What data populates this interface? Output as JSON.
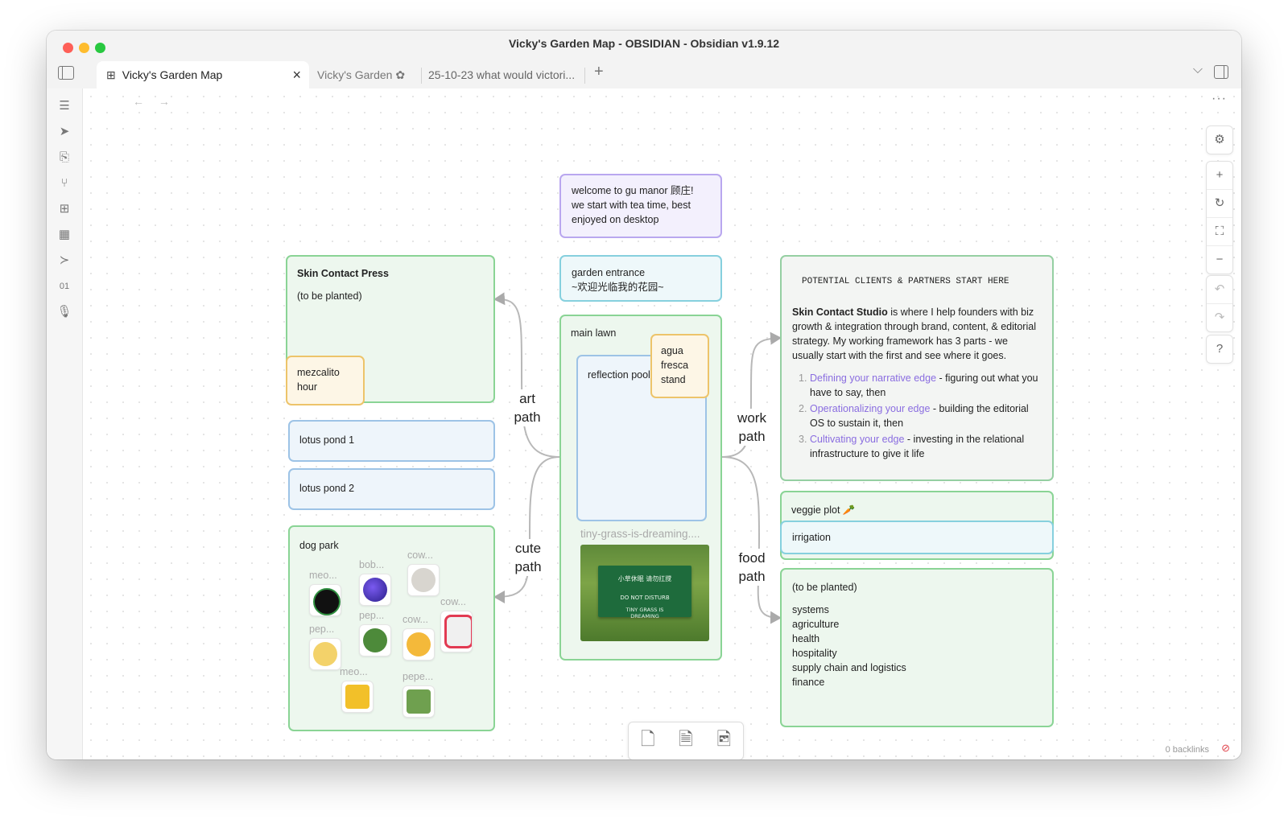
{
  "window": {
    "title": "Vicky's Garden Map - OBSIDIAN - Obsidian v1.9.12"
  },
  "tabs": [
    {
      "label": "Vicky's Garden Map",
      "icon": "canvas-icon"
    },
    {
      "label": "Vicky's Garden ✿"
    },
    {
      "label": "25-10-23 what would victori..."
    }
  ],
  "tab_actions": {
    "new_tab": "+",
    "list": "⌵"
  },
  "ribbon": [
    "files-icon",
    "send-icon",
    "file-search-icon",
    "graph-icon",
    "canvas-icon",
    "calendar-icon",
    "terminal-icon",
    "binary-icon",
    "microphone-icon"
  ],
  "nav": {
    "back": "←",
    "forward": "→",
    "more": "···"
  },
  "controls": {
    "settings": "⚙",
    "zoom_in": "+",
    "reset": "↻",
    "fit": "⛶",
    "zoom_out": "−",
    "undo": "↶",
    "redo": "↷",
    "help": "?"
  },
  "nodes": {
    "welcome": "welcome to gu manor 顾庄!\nwe start with tea time, best enjoyed on desktop",
    "entrance_1": "garden entrance",
    "entrance_2": "~欢迎光临我的花园~",
    "main_lawn": "main lawn",
    "reflection_pool": "reflection pool",
    "agua_fresca": "agua fresca stand",
    "tiny_grass_label": "tiny-grass-is-dreaming....",
    "sign_line1": "小草休眠 请勿扛搅",
    "sign_line2": "DO NOT DISTURB",
    "sign_line3": "TINY GRASS IS DREAMING",
    "skin_contact_press": "Skin Contact Press",
    "to_be_planted": "(to be planted)",
    "mezcalito": "mezcalito hour",
    "lotus1": "lotus pond 1",
    "lotus2": "lotus pond 2",
    "dog_park": "dog park",
    "potential_clients": "POTENTIAL CLIENTS & PARTNERS START HERE",
    "studio_name": "Skin Contact Studio",
    "studio_intro": " is where I help founders with biz growth & integration through brand, content, & editorial strategy. My working framework has 3 parts - we usually start with the first and see where it goes.",
    "steps": [
      {
        "num": "1.",
        "link": "Defining your narrative edge",
        "rest": " - figuring out what you have to say, then"
      },
      {
        "num": "2.",
        "link": "Operationalizing your edge",
        "rest": " - building the editorial OS to sustain it, then"
      },
      {
        "num": "3.",
        "link": "Cultivating your edge",
        "rest": " - investing in the relational infrastructure to give it life"
      }
    ],
    "veggie_plot": "veggie plot 🥕",
    "irrigation": "irrigation",
    "to_be_planted2": "(to be planted)",
    "sectors": [
      "systems",
      "agriculture",
      "health",
      "hospitality",
      "supply chain and logistics",
      "finance"
    ]
  },
  "edges": {
    "art": "art path",
    "cute": "cute path",
    "work": "work path",
    "food": "food path"
  },
  "emoji_labels": [
    "meo...",
    "bob...",
    "cow...",
    "cow...",
    "pep...",
    "pep...",
    "cow...",
    "pep...",
    "meo...",
    "pepe..."
  ],
  "colors": {
    "green": "#8ad495",
    "purple": "#b9a7ef",
    "cyan": "#86d0de",
    "blue": "#9dc3e6",
    "orange": "#edc46a",
    "link": "#8a6de0"
  },
  "bottom_tools": [
    "empty-card-icon",
    "note-card-icon",
    "media-card-icon"
  ],
  "status": {
    "backlinks": "0 backlinks"
  }
}
